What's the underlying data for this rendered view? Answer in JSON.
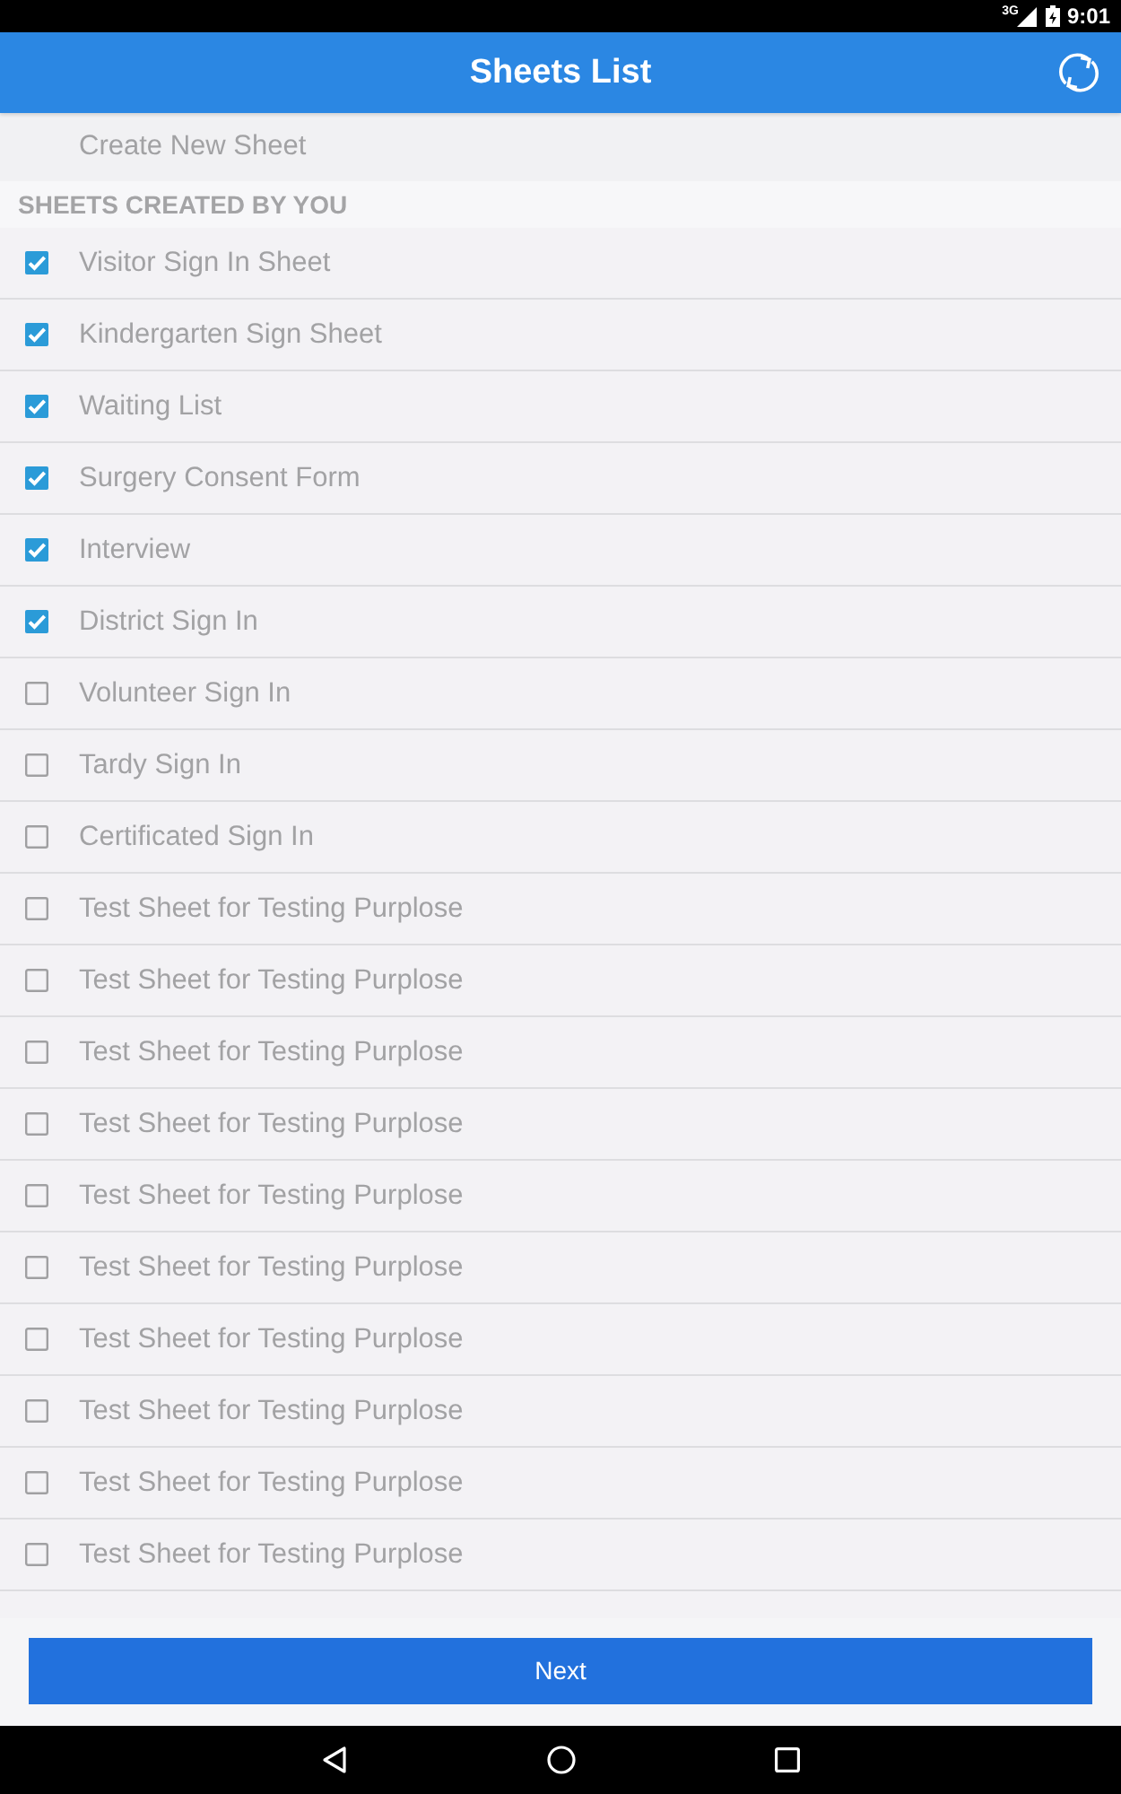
{
  "status_bar": {
    "network": "3G",
    "time": "9:01"
  },
  "app_bar": {
    "title": "Sheets List"
  },
  "create_item": {
    "label": "Create New Sheet"
  },
  "section": {
    "title": "SHEETS CREATED BY YOU"
  },
  "sheets": [
    {
      "name": "Visitor Sign In Sheet",
      "checked": true
    },
    {
      "name": "Kindergarten Sign Sheet",
      "checked": true
    },
    {
      "name": "Waiting List",
      "checked": true
    },
    {
      "name": "Surgery Consent Form",
      "checked": true
    },
    {
      "name": "Interview",
      "checked": true
    },
    {
      "name": "District Sign In",
      "checked": true
    },
    {
      "name": "Volunteer Sign In",
      "checked": false
    },
    {
      "name": "Tardy Sign In",
      "checked": false
    },
    {
      "name": "Certificated Sign In",
      "checked": false
    },
    {
      "name": "Test Sheet for Testing Purplose",
      "checked": false
    },
    {
      "name": "Test Sheet for Testing Purplose",
      "checked": false
    },
    {
      "name": "Test Sheet for Testing Purplose",
      "checked": false
    },
    {
      "name": "Test Sheet for Testing Purplose",
      "checked": false
    },
    {
      "name": "Test Sheet for Testing Purplose",
      "checked": false
    },
    {
      "name": "Test Sheet for Testing Purplose",
      "checked": false
    },
    {
      "name": "Test Sheet for Testing Purplose",
      "checked": false
    },
    {
      "name": "Test Sheet for Testing Purplose",
      "checked": false
    },
    {
      "name": "Test Sheet for Testing Purplose",
      "checked": false
    },
    {
      "name": "Test Sheet for Testing Purplose",
      "checked": false
    }
  ],
  "next_button": {
    "label": "Next"
  }
}
